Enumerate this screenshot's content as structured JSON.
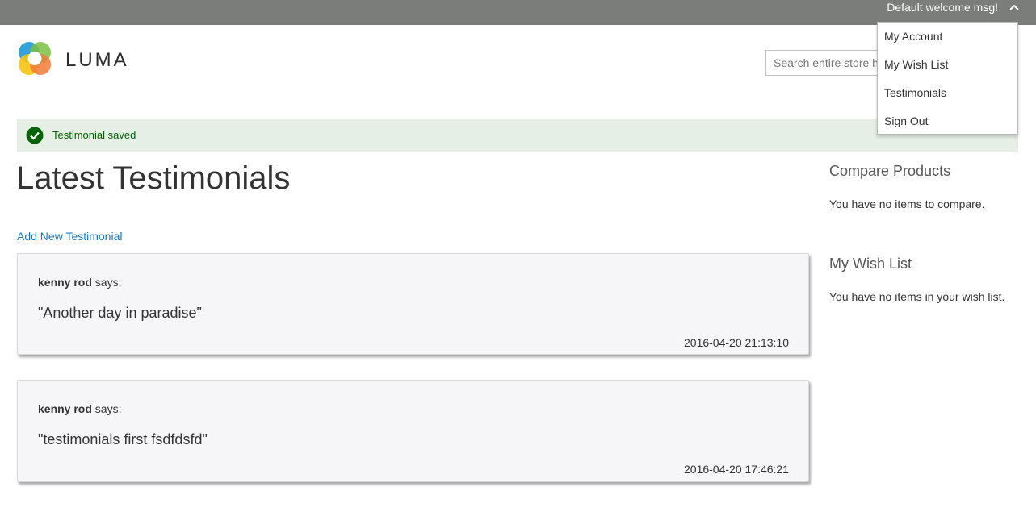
{
  "header": {
    "welcome": "Default welcome msg!",
    "account_menu": [
      "My Account",
      "My Wish List",
      "Testimonials",
      "Sign Out"
    ],
    "brand": "LUMA",
    "search_placeholder": "Search entire store here..."
  },
  "message": {
    "text": "Testimonial saved",
    "color": "#006400",
    "background": "#e5efe5"
  },
  "main": {
    "title": "Latest Testimonials",
    "add_link": "Add New Testimonial",
    "testimonials": [
      {
        "author": "kenny rod",
        "says": "says:",
        "quote": "\"Another day in paradise\"",
        "date": "2016-04-20 21:13:10"
      },
      {
        "author": "kenny rod",
        "says": "says:",
        "quote": "\"testimonials first fsdfdsfd\"",
        "date": "2016-04-20 17:46:21"
      }
    ]
  },
  "sidebar": {
    "compare_title": "Compare Products",
    "compare_text": "You have no items to compare.",
    "wishlist_title": "My Wish List",
    "wishlist_text": "You have no items in your wish list."
  },
  "colors": {
    "topbar": "#7b7d7a",
    "link": "#1979c3",
    "card_bg": "#f6f6f8"
  },
  "icons": {
    "logo": "luma-logo-icon",
    "success": "check-circle-icon",
    "chevron": "chevron-up-icon"
  }
}
